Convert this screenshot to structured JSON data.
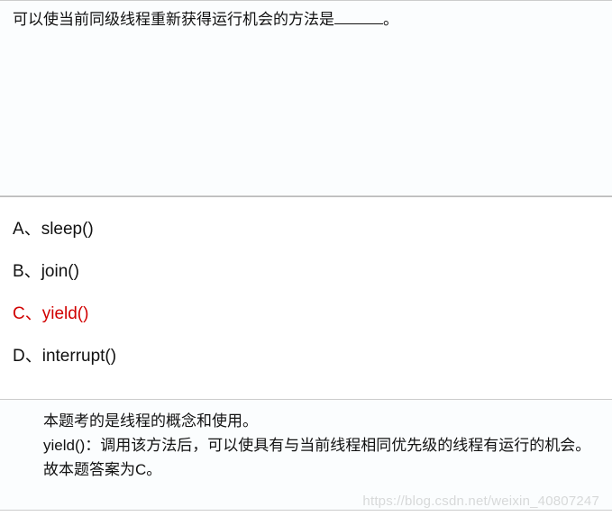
{
  "question": {
    "prefix": "可以使当前同级线程重新获得运行机会的方法是",
    "suffix": "。"
  },
  "options": [
    {
      "label": "A、",
      "text": "sleep()",
      "correct": false
    },
    {
      "label": "B、",
      "text": "join()",
      "correct": false
    },
    {
      "label": "C、",
      "text": "yield()",
      "correct": true
    },
    {
      "label": "D、",
      "text": "interrupt()",
      "correct": false
    }
  ],
  "explanation": {
    "line1": "本题考的是线程的概念和使用。",
    "line2": "yield()：调用该方法后，可以使具有与当前线程相同优先级的线程有运行的机会。",
    "line3": "故本题答案为C。"
  },
  "watermark": "https://blog.csdn.net/weixin_40807247"
}
